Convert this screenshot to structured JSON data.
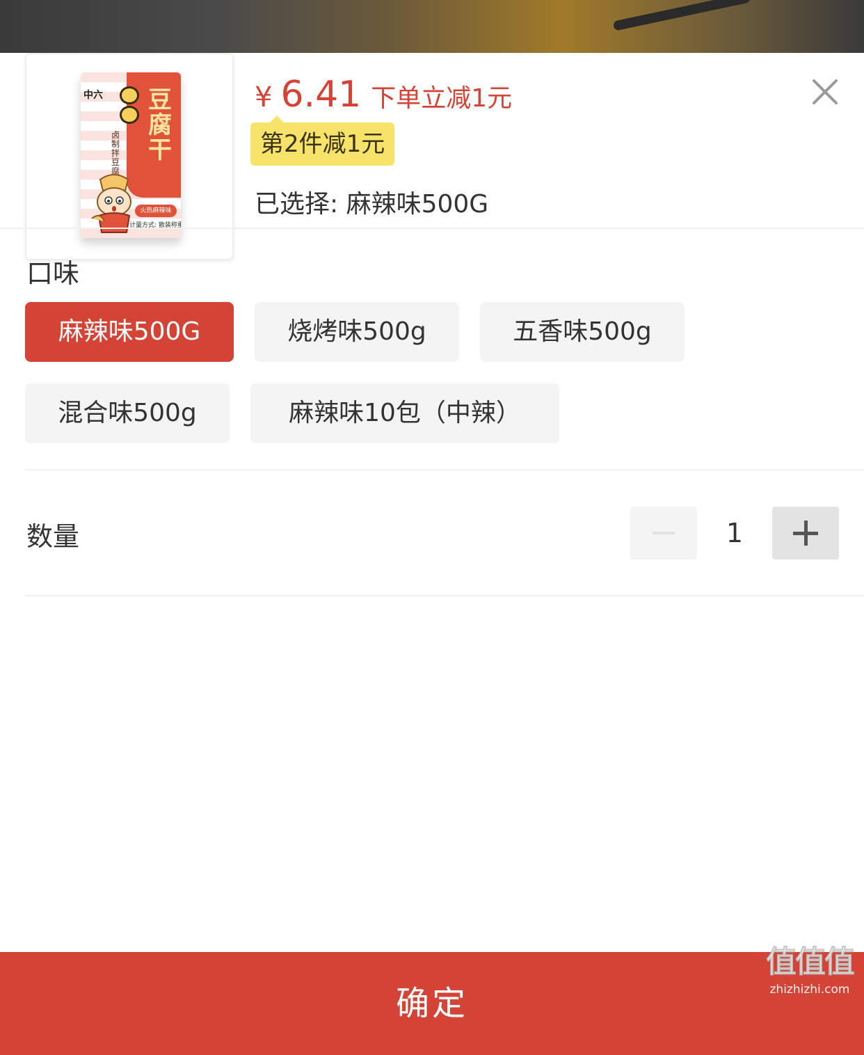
{
  "product": {
    "image_alt": "QQ豆腐干 麻辣味 包装",
    "brand_text": "中六",
    "pack_title": "豆腐干",
    "pack_sub": "卤制拌豆腐干",
    "pack_flavor": "火热麻辣味",
    "pack_meter": "计量方式: 散装称重"
  },
  "price": {
    "currency": "¥",
    "value": "6.41",
    "note": "下单立减1元"
  },
  "promo_tag": "第2件减1元",
  "selected_text": "已选择: 麻辣味500G",
  "flavor_section": {
    "label": "口味",
    "options": [
      {
        "label": "麻辣味500G",
        "selected": true
      },
      {
        "label": "烧烤味500g",
        "selected": false
      },
      {
        "label": "五香味500g",
        "selected": false
      },
      {
        "label": "混合味500g",
        "selected": false
      },
      {
        "label": "麻辣味10包（中辣）",
        "selected": false
      }
    ]
  },
  "quantity": {
    "label": "数量",
    "value": "1"
  },
  "confirm_label": "确定",
  "watermark": {
    "main": "值值值",
    "sub": "zhizhizhi.com"
  },
  "colors": {
    "accent": "#d34336",
    "promo_bg": "#f7e36a",
    "option_bg": "#f4f4f4"
  },
  "icons": {
    "close": "close-icon",
    "minus": "minus-icon",
    "plus": "plus-icon"
  }
}
